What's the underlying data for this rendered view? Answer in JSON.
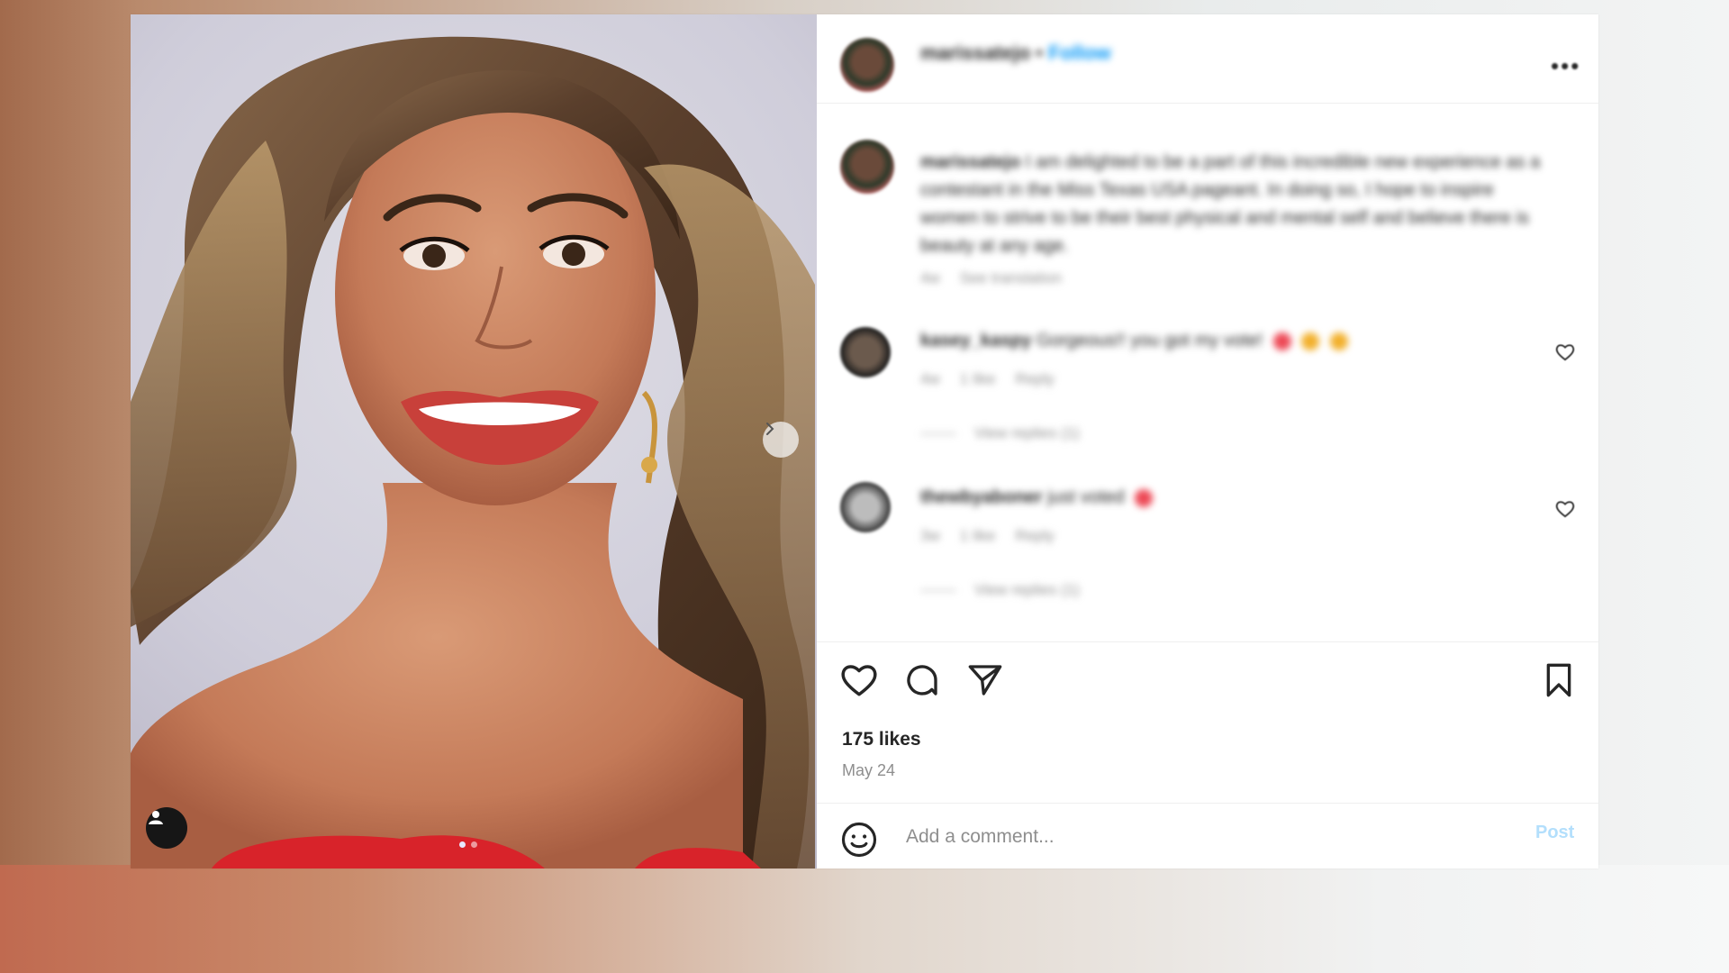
{
  "post": {
    "photo_alt": "Portrait photo of smiling woman with long wavy hair in red dress",
    "carousel": {
      "total": 2,
      "current": 1
    }
  },
  "header": {
    "username": "marissatejo",
    "separator": "•",
    "follow_label": "Follow"
  },
  "caption": {
    "username": "marissatejo",
    "text": "I am delighted to be a part of this incredible new experience as a contestant in the Miss Texas USA pageant. In doing so, I hope to inspire women to strive to be their best physical and mental self and believe there is beauty at any age.",
    "time": "4w",
    "see_translation": "See translation"
  },
  "comments": [
    {
      "username": "kasey_kaspy",
      "text": "Gorgeous!! you got my vote!",
      "time": "4w",
      "likes": "1 like",
      "reply": "Reply",
      "view_replies": "View replies (1)"
    },
    {
      "username": "thewbyaboner",
      "text": "just voted",
      "time": "3w",
      "likes": "1 like",
      "reply": "Reply",
      "view_replies": "View replies (1)"
    }
  ],
  "actions": {
    "likes": "175 likes",
    "date": "May 24"
  },
  "comment_box": {
    "placeholder": "Add a comment...",
    "post_label": "Post"
  },
  "colors": {
    "accent": "#0095f6",
    "post_disabled": "#b3dffc",
    "text": "#262626",
    "muted": "#8e8e8e",
    "heart_emoji": "#ed4956"
  },
  "icons": [
    "next-arrow-icon",
    "user-tag-icon",
    "more-options-icon",
    "heart-icon",
    "comment-icon",
    "share-icon",
    "bookmark-icon",
    "emoji-icon"
  ]
}
